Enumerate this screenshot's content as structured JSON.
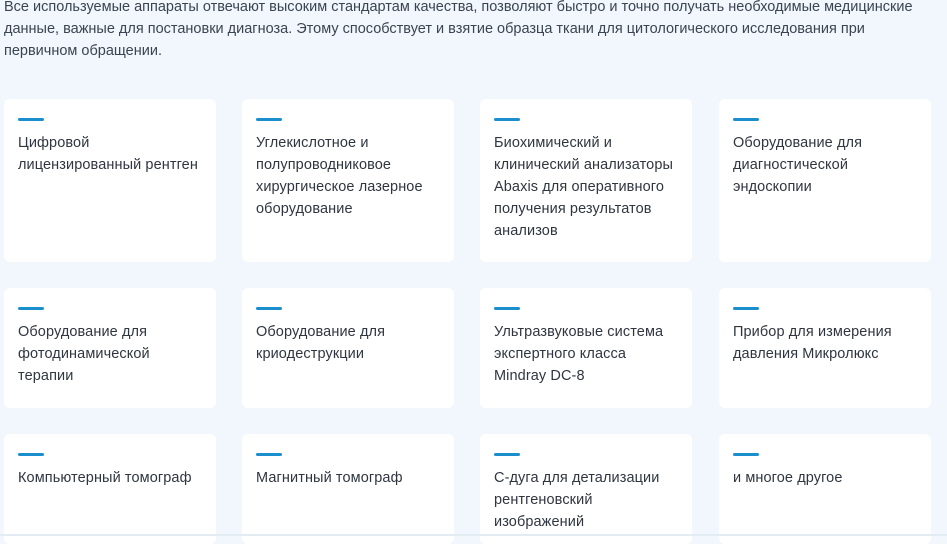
{
  "intro": {
    "text": "Все используемые аппараты отвечают высоким стандартам качества, позволяют быстро и точно получать необходимые медицинские данные, важные для постановки диагноза. Этому способствует и взятие образца ткани для цитологического исследования при первичном обращении."
  },
  "colors": {
    "accent": "#1b8fce",
    "background": "#f1f7fc",
    "card": "#ffffff",
    "text": "#2f3640"
  },
  "equipment": [
    {
      "label": "Цифровой лицензированный рентген"
    },
    {
      "label": "Углекислотное и полупроводниковое хирургическое лазерное оборудование"
    },
    {
      "label": "Биохимический и клинический анализаторы Abaxis для оперативного получения результатов анализов"
    },
    {
      "label": "Оборудование для диагностической эндоскопии"
    },
    {
      "label": "Оборудование для фотодинамической терапии"
    },
    {
      "label": "Оборудование для криодеструкции"
    },
    {
      "label": "Ультразвуковые система экспертного класса Mindray DC-8"
    },
    {
      "label": "Прибор для измерения давления Микролюкс"
    },
    {
      "label": "Компьютерный томограф"
    },
    {
      "label": "Магнитный томограф"
    },
    {
      "label": "С-дуга для детализации рентгеновский изображений"
    },
    {
      "label": "и многое другое"
    }
  ]
}
